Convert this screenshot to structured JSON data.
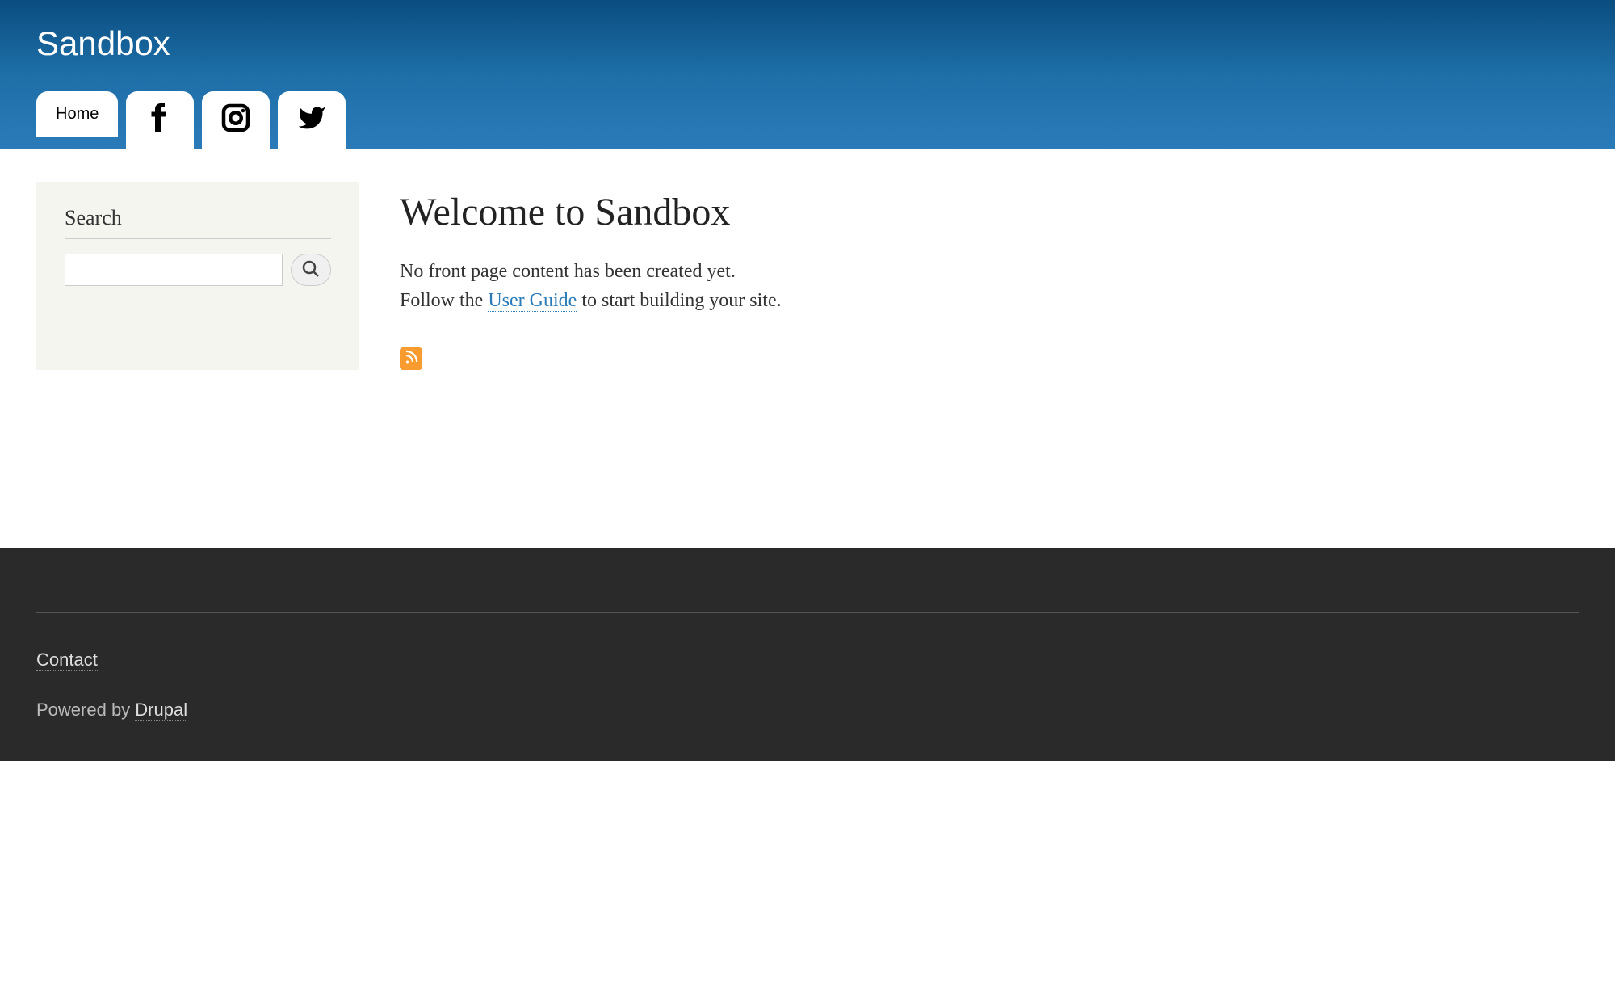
{
  "header": {
    "site_title": "Sandbox",
    "nav_home": "Home"
  },
  "sidebar": {
    "search_label": "Search"
  },
  "main": {
    "page_title": "Welcome to Sandbox",
    "no_content_text": "No front page content has been created yet.",
    "follow_text_before": "Follow the ",
    "user_guide_link": "User Guide",
    "follow_text_after": " to start building your site."
  },
  "footer": {
    "contact_label": "Contact",
    "powered_by_text": "Powered by ",
    "drupal_label": "Drupal"
  }
}
